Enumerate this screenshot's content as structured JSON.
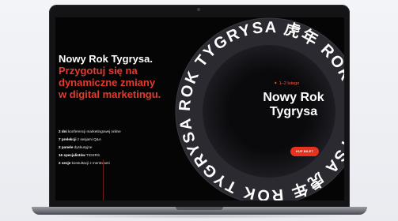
{
  "hero": {
    "headline_white": "Nowy Rok Tygrysa.",
    "headline_red": [
      "Przygotuj się na",
      "dynamiczne zmiany",
      "w digital marketingu."
    ]
  },
  "facts": [
    {
      "bold": "2 dni",
      "text": " konferencji marketingowej online"
    },
    {
      "bold": "7 prelekcji",
      "text": " z sesjami Q&A"
    },
    {
      "bold": "2 panele",
      "text": " dyskusyjne"
    },
    {
      "bold": "16 specjalistów",
      "text": " TIGERS"
    },
    {
      "bold": "2 sesje",
      "text": " konsultacji z mentorami"
    }
  ],
  "ring": {
    "text": "ROK TYGRYSA 虎年 ROK TYGRYSA 虎年 ROK TYGRYSA 虎年",
    "accent_color": "#e63a2e"
  },
  "event": {
    "date": "1–2 lutego",
    "title_line1": "Nowy Rok",
    "title_line2": "Tygrysa",
    "buy_label": "KUP BILET"
  },
  "colors": {
    "accent_red": "#e6321f",
    "screen_bg": "#050506",
    "text_white": "#ffffff"
  },
  "icons": {
    "date_marker": "spark-icon",
    "camera": "camera-dot"
  }
}
